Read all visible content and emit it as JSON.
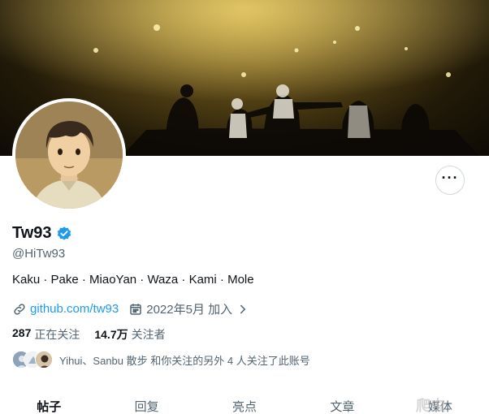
{
  "profile": {
    "display_name": "Tw93",
    "handle": "@HiTw93",
    "bio": "Kaku · Pake · MiaoYan · Waza · Kami · Mole",
    "website": "github.com/tw93",
    "joined": "2022年5月 加入",
    "following_count": "287",
    "following_label": "正在关注",
    "followers_count": "14.7万",
    "followers_label": "关注者",
    "known_followers": "Yihui、Sanbu 散步 和你关注的另外 4 人关注了此账号"
  },
  "tabs": [
    {
      "label": "帖子",
      "active": true
    },
    {
      "label": "回复",
      "active": false
    },
    {
      "label": "亮点",
      "active": false
    },
    {
      "label": "文章",
      "active": false
    },
    {
      "label": "媒体",
      "active": false
    }
  ],
  "watermark": "爬虫",
  "icons": {
    "more": "more-icon",
    "verified": "verified-badge-icon",
    "link": "link-icon",
    "calendar": "calendar-icon",
    "chevron": "chevron-right-icon"
  },
  "colors": {
    "accent": "#1d9bf0",
    "text": "#0f1419",
    "muted": "#536471"
  }
}
